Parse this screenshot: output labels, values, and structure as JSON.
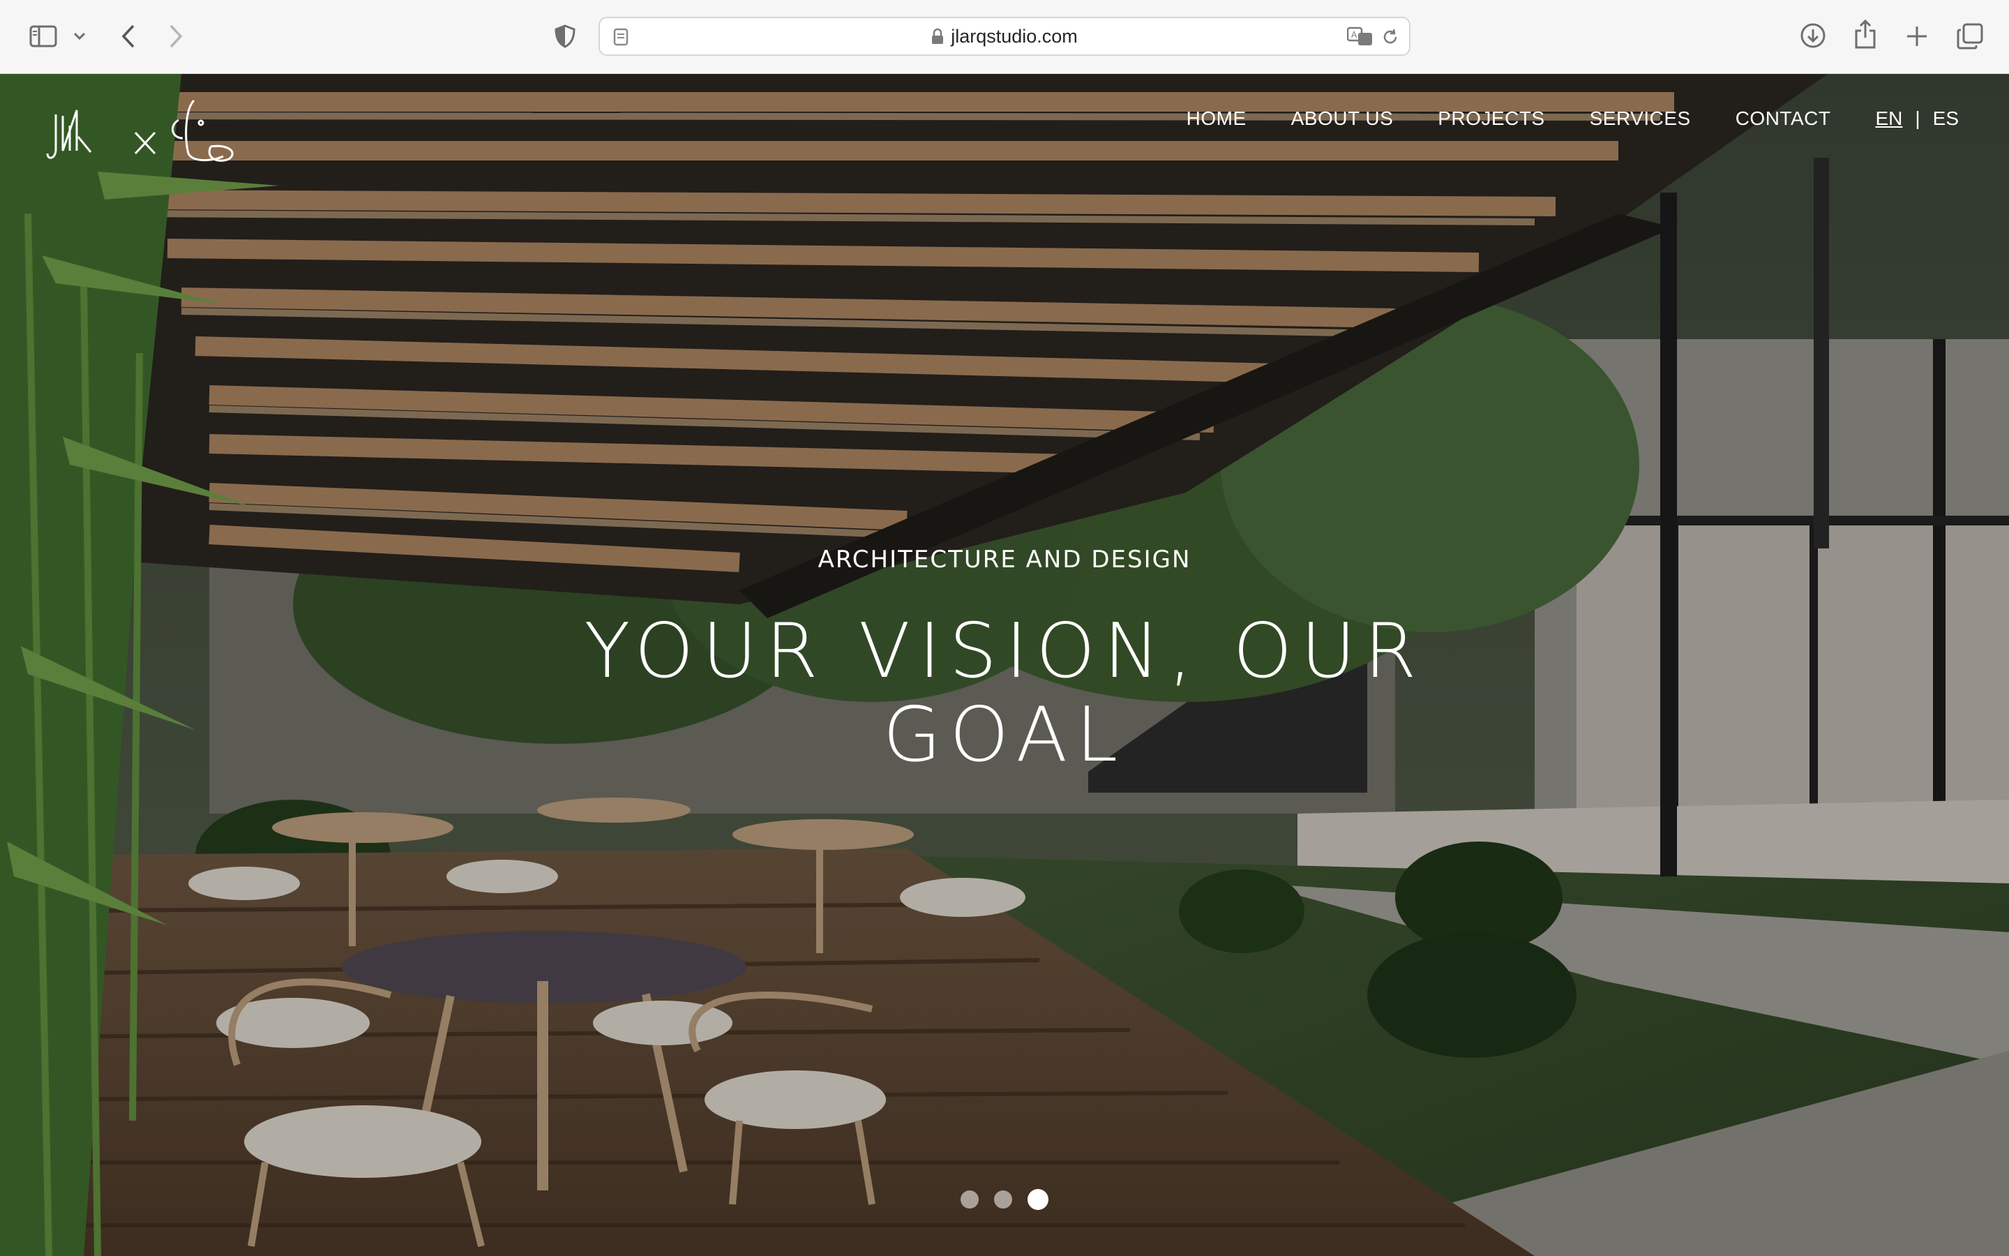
{
  "browser": {
    "url": "jlarqstudio.com",
    "icons": {
      "sidebar": "sidebar-icon",
      "sidebar_menu": "chevron-down-icon",
      "back": "chevron-left-icon",
      "forward": "chevron-right-icon",
      "privacy": "shield-icon",
      "page": "page-icon",
      "lock": "lock-icon",
      "translate": "translate-icon",
      "reload": "reload-icon",
      "downloads": "download-icon",
      "share": "share-icon",
      "new_tab": "plus-icon",
      "tabs": "tabs-overview-icon"
    }
  },
  "site": {
    "nav": {
      "home": "HOME",
      "about": "ABOUT US",
      "projects": "PROJECTS",
      "services": "SERVICES",
      "contact": "CONTACT"
    },
    "lang": {
      "en": "EN",
      "separator": "|",
      "es": "ES"
    },
    "hero": {
      "kicker": "ARCHITECTURE AND DESIGN",
      "title": "YOUR VISION, OUR GOAL"
    },
    "slider": {
      "slide_count": 3,
      "active_slide": 3
    }
  },
  "colors": {
    "chrome_bg": "#f6f6f6",
    "hero_text": "#ffffff",
    "wood": "#9a7b5e",
    "foliage": "#2f4a2a"
  }
}
